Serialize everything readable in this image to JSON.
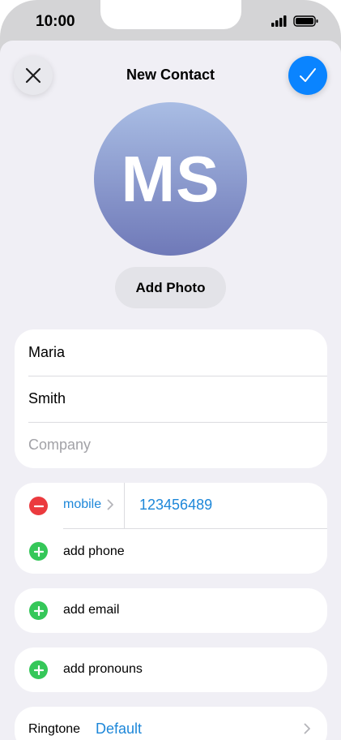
{
  "status_bar": {
    "time": "10:00"
  },
  "nav": {
    "title": "New Contact"
  },
  "avatar": {
    "initials": "MS",
    "add_photo_label": "Add Photo"
  },
  "name_fields": {
    "first_name": "Maria",
    "last_name": "Smith",
    "company_placeholder": "Company"
  },
  "phone": {
    "type_label": "mobile",
    "number": "123456489",
    "add_label": "add phone"
  },
  "email": {
    "add_label": "add email"
  },
  "pronouns": {
    "add_label": "add pronouns"
  },
  "ringtone": {
    "label": "Ringtone",
    "value": "Default"
  },
  "colors": {
    "accent": "#0a84ff",
    "link": "#1d87d9",
    "remove": "#eb3a3e",
    "add": "#35c759",
    "background": "#f0eff5"
  }
}
